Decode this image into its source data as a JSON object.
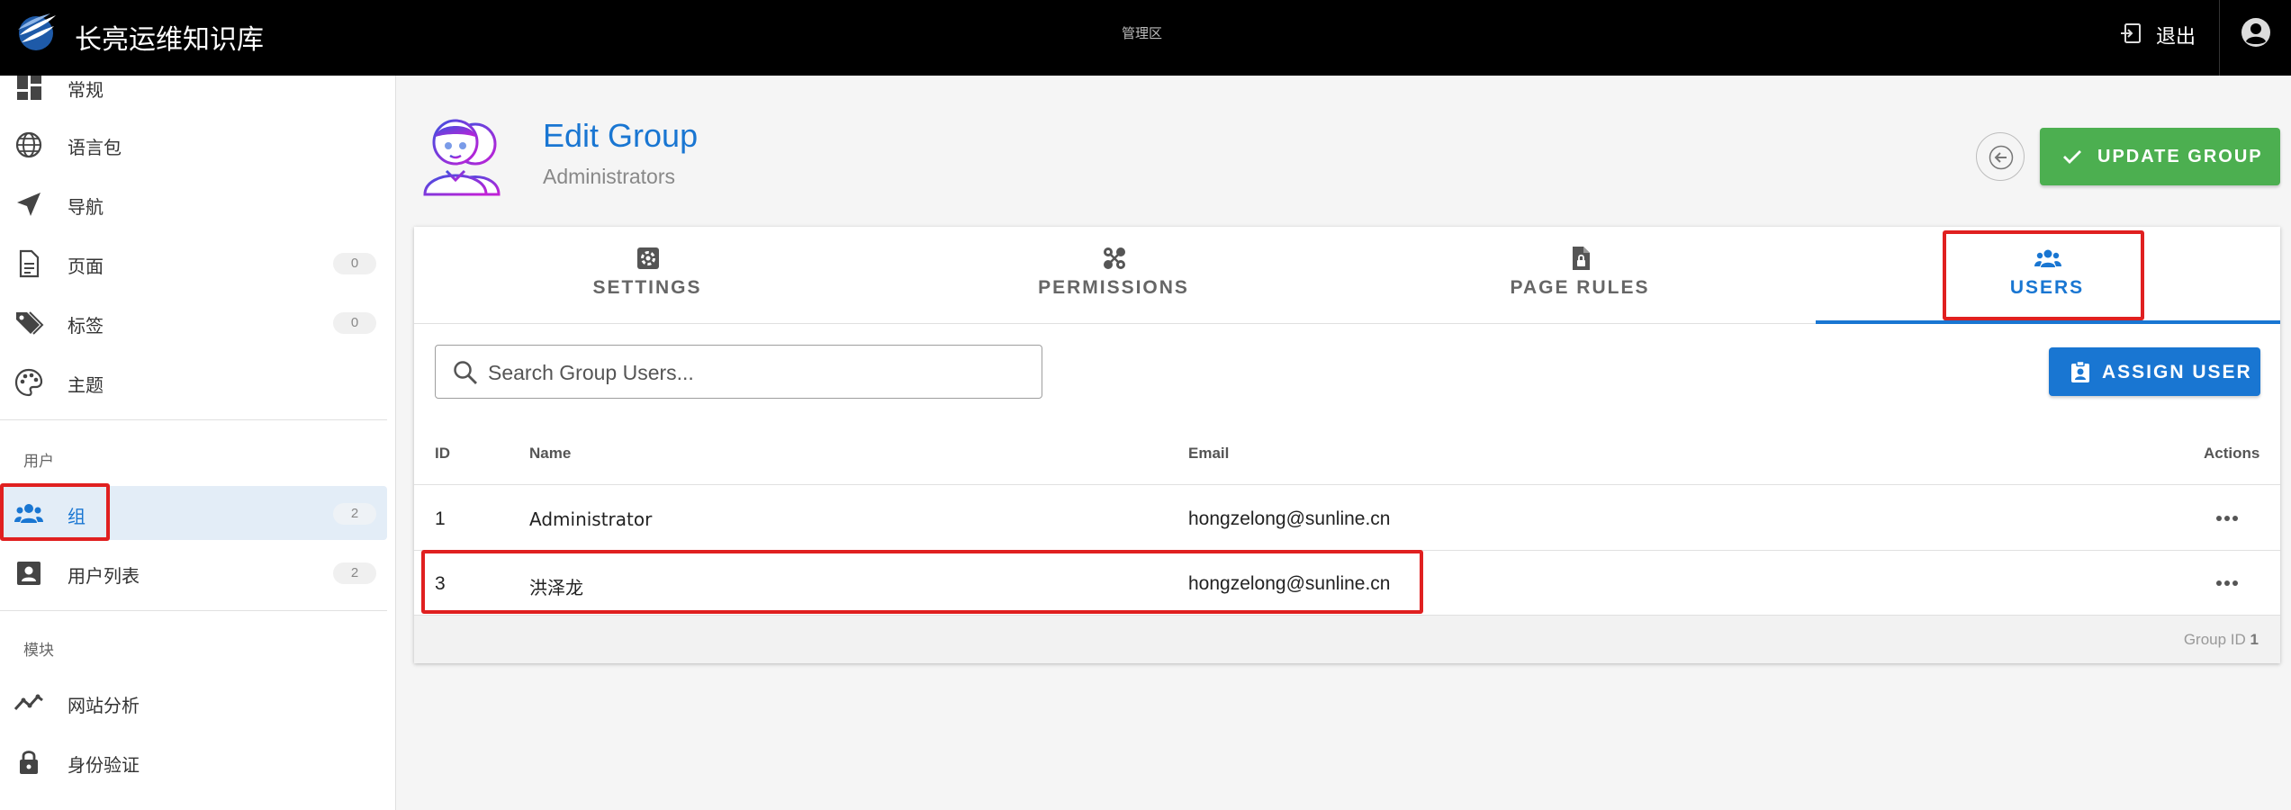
{
  "topbar": {
    "app_title": "长亮运维知识库",
    "admin_area": "管理区",
    "logout_label": "退出"
  },
  "sidebar": {
    "items": [
      {
        "label": "常规",
        "icon": "dashboard-icon"
      },
      {
        "label": "语言包",
        "icon": "globe-icon"
      },
      {
        "label": "导航",
        "icon": "navigation-icon"
      },
      {
        "label": "页面",
        "icon": "page-icon",
        "count": "0"
      },
      {
        "label": "标签",
        "icon": "tags-icon",
        "count": "0"
      },
      {
        "label": "主题",
        "icon": "palette-icon"
      }
    ],
    "users_section": "用户",
    "user_items": [
      {
        "label": "组",
        "icon": "groups-icon",
        "count": "2"
      },
      {
        "label": "用户列表",
        "icon": "user-card-icon",
        "count": "2"
      }
    ],
    "modules_section": "模块",
    "module_items": [
      {
        "label": "网站分析",
        "icon": "analytics-icon"
      },
      {
        "label": "身份验证",
        "icon": "lock-icon"
      }
    ]
  },
  "header": {
    "title": "Edit Group",
    "subtitle": "Administrators",
    "update_label": "UPDATE GROUP"
  },
  "tabs": [
    {
      "label": "SETTINGS",
      "icon": "settings-icon"
    },
    {
      "label": "PERMISSIONS",
      "icon": "permissions-icon"
    },
    {
      "label": "PAGE RULES",
      "icon": "page-rules-icon"
    },
    {
      "label": "USERS",
      "icon": "users-icon",
      "active": true
    }
  ],
  "search": {
    "placeholder": "Search Group Users..."
  },
  "assign_label": "ASSIGN USER",
  "table": {
    "columns": [
      "ID",
      "Name",
      "Email",
      "Actions"
    ],
    "rows": [
      {
        "id": "1",
        "name": "Administrator",
        "email": "hongzelong@sunline.cn"
      },
      {
        "id": "3",
        "name": "洪泽龙",
        "email": "hongzelong@sunline.cn"
      }
    ]
  },
  "footer": {
    "group_id_label": "Group ID",
    "group_id": "1"
  },
  "colors": {
    "accent": "#1976d2",
    "success": "#4caf50",
    "annotation": "#e02020",
    "topbar": "#000000"
  }
}
